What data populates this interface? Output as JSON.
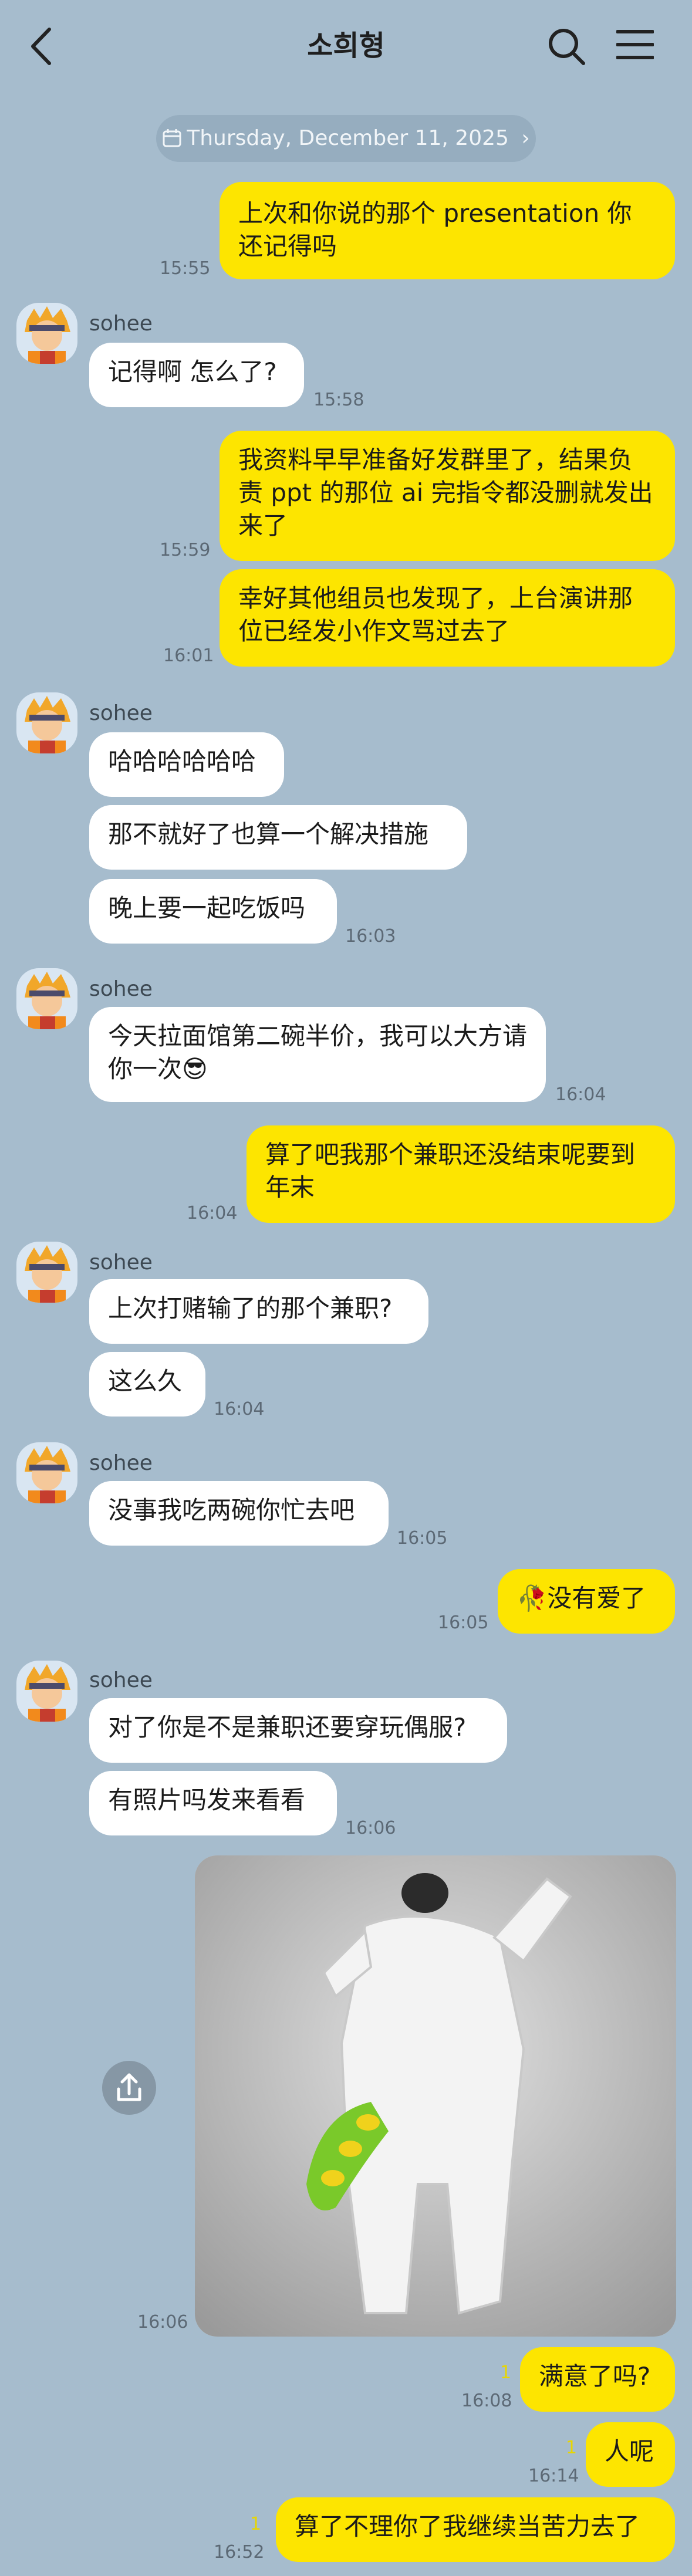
{
  "header": {
    "title": "소희형"
  },
  "date_pill": {
    "label": "Thursday, December 11, 2025",
    "chevron": "›"
  },
  "partner": {
    "name": "sohee"
  },
  "messages": [
    {
      "side": "me",
      "text": "上次和你说的那个 presentation 你还记得吗",
      "time": "15:55"
    },
    {
      "side": "them",
      "text": "记得啊 怎么了?",
      "time": "15:58"
    },
    {
      "side": "me",
      "text": "我资料早早准备好发群里了，结果负责 ppt 的那位 ai 完指令都没删就发出来了",
      "time": "15:59"
    },
    {
      "side": "me",
      "text": "幸好其他组员也发现了，上台演讲那位已经发小作文骂过去了",
      "time": "16:01"
    },
    {
      "side": "them",
      "text": "哈哈哈哈哈哈",
      "time": ""
    },
    {
      "side": "them",
      "text": "那不就好了也算一个解决措施",
      "time": ""
    },
    {
      "side": "them",
      "text": "晚上要一起吃饭吗",
      "time": "16:03"
    },
    {
      "side": "them",
      "text": "今天拉面馆第二碗半价，我可以大方请你一次😎",
      "time": "16:04"
    },
    {
      "side": "me",
      "text": "算了吧我那个兼职还没结束呢要到年末",
      "time": "16:04"
    },
    {
      "side": "them",
      "text": "上次打赌输了的那个兼职?",
      "time": ""
    },
    {
      "side": "them",
      "text": "这么久",
      "time": "16:04"
    },
    {
      "side": "them",
      "text": "没事我吃两碗你忙去吧",
      "time": "16:05"
    },
    {
      "side": "me",
      "text": "🥀没有爱了",
      "time": "16:05"
    },
    {
      "side": "them",
      "text": "对了你是不是兼职还要穿玩偶服?",
      "time": ""
    },
    {
      "side": "them",
      "text": "有照片吗发来看看",
      "time": "16:06"
    },
    {
      "side": "me",
      "text": "满意了吗?",
      "time": "16:08",
      "read": "1"
    },
    {
      "side": "me",
      "text": "人呢",
      "time": "16:14",
      "read": "1"
    },
    {
      "side": "me",
      "text": "算了不理你了我继续当苦力去了",
      "time": "16:52",
      "read": "1"
    }
  ],
  "photo": {
    "time": "16:06"
  },
  "icons": {
    "back": "chevron-left-icon",
    "search": "search-icon",
    "menu": "menu-icon",
    "calendar": "calendar-icon",
    "share": "share-icon"
  },
  "colors": {
    "background": "#a6bccd",
    "my_bubble": "#fde500",
    "their_bubble": "#ffffff"
  }
}
